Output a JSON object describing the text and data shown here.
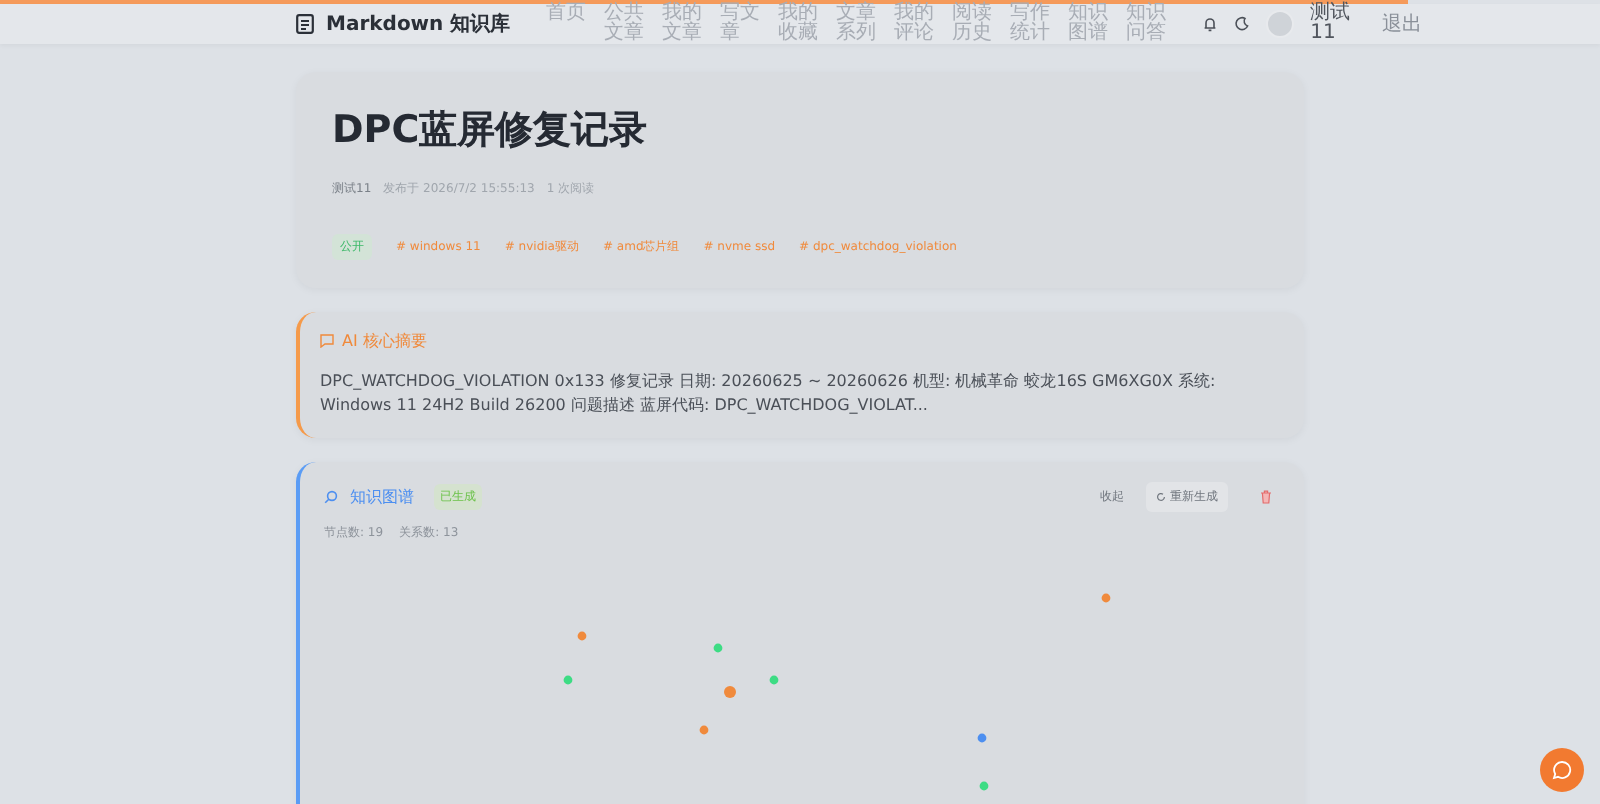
{
  "reading_progress": {
    "level": 0.88
  },
  "header": {
    "brand": "Markdown 知识库",
    "nav": [
      "首页",
      "公共文章",
      "我的文章",
      "写文章",
      "我的收藏",
      "文章系列",
      "我的评论",
      "阅读历史",
      "写作统计",
      "知识图谱",
      "知识问答"
    ],
    "user": "测试11",
    "logout": "退出"
  },
  "article": {
    "title": "DPC蓝屏修复记录",
    "author": "测试11",
    "published": "发布于 2026/7/2 15:55:13",
    "reads": "1 次阅读",
    "visibility": "公开",
    "tags": [
      "# windows 11",
      "# nvidia驱动",
      "# amd芯片组",
      "# nvme ssd",
      "# dpc_watchdog_violation"
    ]
  },
  "summary": {
    "title": "AI 核心摘要",
    "text": "DPC_WATCHDOG_VIOLATION 0x133 修复记录 日期: 20260625 ~ 20260626 机型: 机械革命 蛟龙16S GM6XG0X 系统: Windows 11 24H2 Build 26200 问题描述 蓝屏代码: DPC_WATCHDOG_VIOLAT..."
  },
  "knowledge_graph": {
    "title": "知识图谱",
    "status": "已生成",
    "collapse": "收起",
    "regenerate": "重新生成",
    "nodes": "节点数: 19",
    "relations": "关系数: 13"
  }
}
